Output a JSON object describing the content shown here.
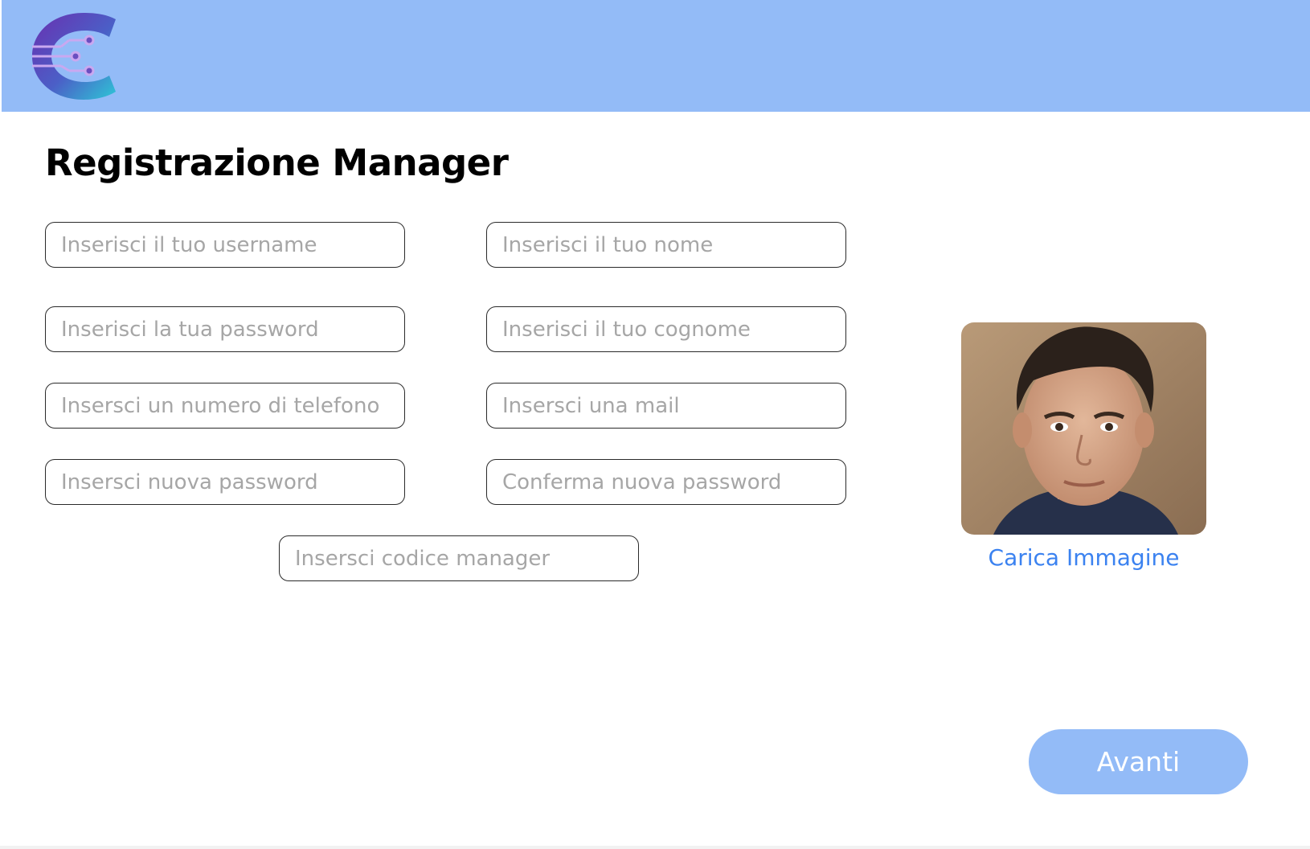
{
  "header": {
    "logo_icon": "circuit-c-logo-icon",
    "background_color": "#93bbf7"
  },
  "page": {
    "title": "Registrazione Manager"
  },
  "form": {
    "username_placeholder": "Inserisci il tuo username",
    "nome_placeholder": "Inserisci il tuo nome",
    "password_placeholder": "Inserisci la tua password",
    "cognome_placeholder": "Inserisci il tuo cognome",
    "telefono_placeholder": "Insersci un numero di telefono",
    "mail_placeholder": "Insersci una mail",
    "new_password_placeholder": "Insersci nuova password",
    "confirm_password_placeholder": "Conferma nuova password",
    "manager_code_placeholder": "Insersci codice manager"
  },
  "profile": {
    "upload_label": "Carica Immagine",
    "link_color": "#3b82f0"
  },
  "actions": {
    "next_label": "Avanti",
    "button_color": "#93bbf7"
  }
}
